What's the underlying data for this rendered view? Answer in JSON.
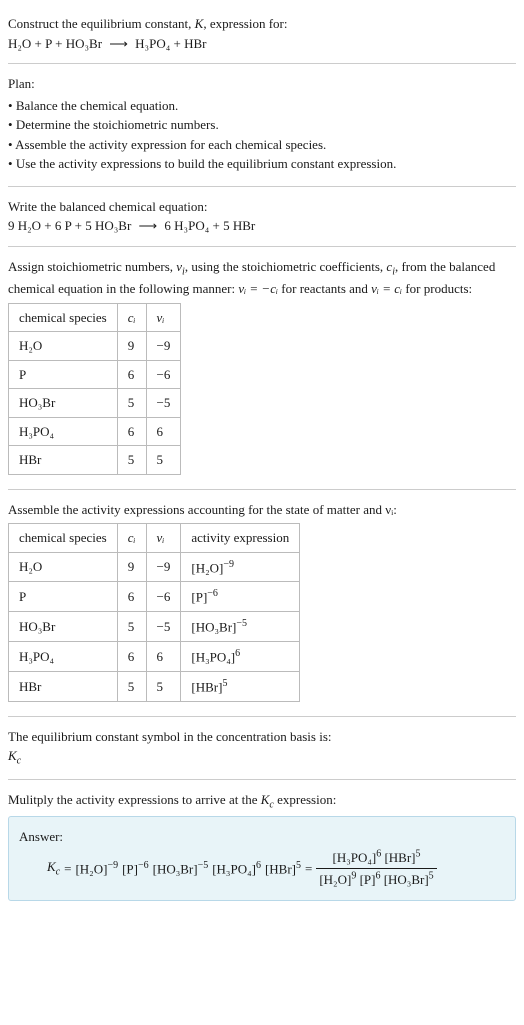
{
  "header": {
    "line1": "Construct the equilibrium constant, ",
    "K": "K",
    "line1b": ", expression for:",
    "reaction_left": "H₂O + P + HO₃Br",
    "arrow": "⟶",
    "reaction_right": "H₃PO₄ + HBr"
  },
  "plan": {
    "title": "Plan:",
    "items": [
      "Balance the chemical equation.",
      "Determine the stoichiometric numbers.",
      "Assemble the activity expression for each chemical species.",
      "Use the activity expressions to build the equilibrium constant expression."
    ]
  },
  "balanced": {
    "title": "Write the balanced chemical equation:",
    "left": "9 H₂O + 6 P + 5 HO₃Br",
    "arrow": "⟶",
    "right": "6 H₃PO₄ + 5 HBr"
  },
  "stoich": {
    "text1": "Assign stoichiometric numbers, ",
    "nu": "ν",
    "sub_i": "i",
    "text2": ", using the stoichiometric coefficients, ",
    "c": "c",
    "text3": ", from the balanced chemical equation in the following manner: ",
    "eq1": "νᵢ = −cᵢ",
    "text4": " for reactants and ",
    "eq2": "νᵢ = cᵢ",
    "text5": " for products:",
    "headers": [
      "chemical species",
      "cᵢ",
      "νᵢ"
    ],
    "rows": [
      {
        "species": "H₂O",
        "c": "9",
        "nu": "−9"
      },
      {
        "species": "P",
        "c": "6",
        "nu": "−6"
      },
      {
        "species": "HO₃Br",
        "c": "5",
        "nu": "−5"
      },
      {
        "species": "H₃PO₄",
        "c": "6",
        "nu": "6"
      },
      {
        "species": "HBr",
        "c": "5",
        "nu": "5"
      }
    ]
  },
  "activity": {
    "title": "Assemble the activity expressions accounting for the state of matter and νᵢ:",
    "headers": [
      "chemical species",
      "cᵢ",
      "νᵢ",
      "activity expression"
    ],
    "rows": [
      {
        "species": "H₂O",
        "c": "9",
        "nu": "−9",
        "expr_base": "[H₂O]",
        "expr_exp": "−9"
      },
      {
        "species": "P",
        "c": "6",
        "nu": "−6",
        "expr_base": "[P]",
        "expr_exp": "−6"
      },
      {
        "species": "HO₃Br",
        "c": "5",
        "nu": "−5",
        "expr_base": "[HO₃Br]",
        "expr_exp": "−5"
      },
      {
        "species": "H₃PO₄",
        "c": "6",
        "nu": "6",
        "expr_base": "[H₃PO₄]",
        "expr_exp": "6"
      },
      {
        "species": "HBr",
        "c": "5",
        "nu": "5",
        "expr_base": "[HBr]",
        "expr_exp": "5"
      }
    ]
  },
  "symbol": {
    "line1": "The equilibrium constant symbol in the concentration basis is:",
    "Kc": "K",
    "sub_c": "c"
  },
  "multiply": {
    "line1": "Mulitply the activity expressions to arrive at the ",
    "Kc": "K",
    "sub_c": "c",
    "line2": " expression:"
  },
  "answer": {
    "label": "Answer:",
    "Kc": "K",
    "sub_c": "c",
    "equals": "=",
    "terms": [
      {
        "base": "[H₂O]",
        "exp": "−9"
      },
      {
        "base": "[P]",
        "exp": "−6"
      },
      {
        "base": "[HO₃Br]",
        "exp": "−5"
      },
      {
        "base": "[H₃PO₄]",
        "exp": "6"
      },
      {
        "base": "[HBr]",
        "exp": "5"
      }
    ],
    "frac_num": [
      {
        "base": "[H₃PO₄]",
        "exp": "6"
      },
      {
        "base": "[HBr]",
        "exp": "5"
      }
    ],
    "frac_den": [
      {
        "base": "[H₂O]",
        "exp": "9"
      },
      {
        "base": "[P]",
        "exp": "6"
      },
      {
        "base": "[HO₃Br]",
        "exp": "5"
      }
    ]
  }
}
